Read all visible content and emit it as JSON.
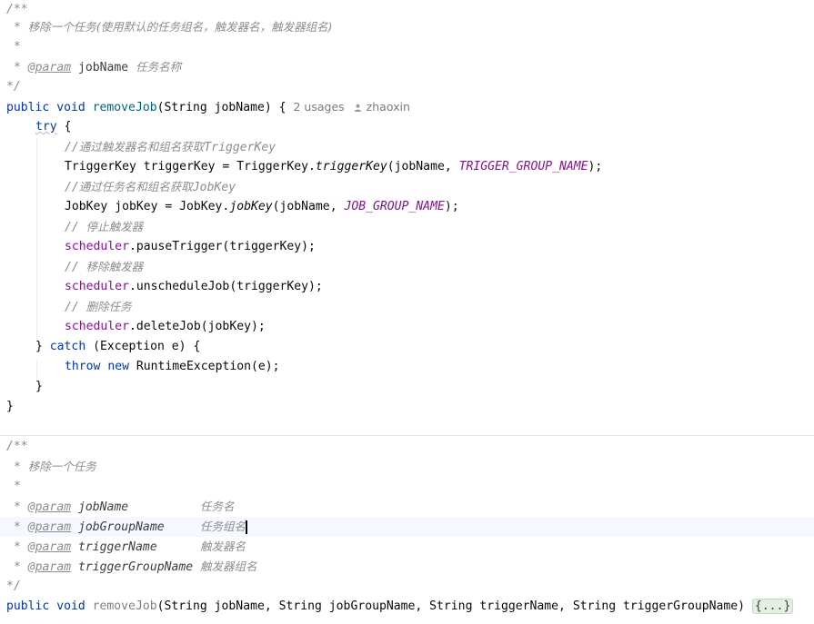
{
  "method1": {
    "doc_open": "/**",
    "doc_desc": "移除一个任务(使用默认的任务组名，触发器名，触发器组名)",
    "doc_star": "*",
    "doc_tag": "@param",
    "doc_param_name": "jobName",
    "doc_param_desc": "任务名称",
    "doc_close": "*/",
    "sig_public": "public",
    "sig_void": "void",
    "sig_name": "removeJob",
    "sig_params": "(String jobName) {",
    "usages": "2 usages",
    "author": "zhaoxin",
    "kw_try": "try",
    "brace_open": " {",
    "c1": "//",
    "c1_text": "通过触发器名和组名获取",
    "c1_tail": "TriggerKey",
    "l_triggerkey_a": "TriggerKey triggerKey = TriggerKey.",
    "l_triggerkey_m": "triggerKey",
    "l_triggerkey_b": "(jobName, ",
    "l_triggerkey_c": "TRIGGER_GROUP_NAME",
    "l_triggerkey_d": ");",
    "c2": "//",
    "c2_text": "通过任务名和组名获取",
    "c2_tail": "JobKey",
    "l_jobkey_a": "JobKey jobKey = JobKey.",
    "l_jobkey_m": "jobKey",
    "l_jobkey_b": "(jobName, ",
    "l_jobkey_c": "JOB_GROUP_NAME",
    "l_jobkey_d": ");",
    "c3": "// ",
    "c3_text": "停止触发器",
    "scheduler": "scheduler",
    "l_pause": ".pauseTrigger(triggerKey);",
    "c4": "// ",
    "c4_text": "移除触发器",
    "l_unschedule": ".unscheduleJob(triggerKey);",
    "c5": "// ",
    "c5_text": "删除任务",
    "l_delete": ".deleteJob(jobKey);",
    "catch_a": "} ",
    "kw_catch": "catch",
    "catch_b": " (Exception e) {",
    "kw_throw": "throw",
    "kw_new": "new",
    "throw_rest": " RuntimeException(e);",
    "close_inner": "}",
    "close_outer": "}"
  },
  "method2": {
    "doc_open": "/**",
    "doc_desc": "移除一个任务",
    "doc_star": "*",
    "params": [
      {
        "tag": "@param",
        "name": "jobName",
        "pad": "          ",
        "desc": "任务名"
      },
      {
        "tag": "@param",
        "name": "jobGroupName",
        "pad": "     ",
        "desc": "任务组名"
      },
      {
        "tag": "@param",
        "name": "triggerName",
        "pad": "      ",
        "desc": "触发器名"
      },
      {
        "tag": "@param",
        "name": "triggerGroupName",
        "pad": " ",
        "desc": "触发器组名"
      }
    ],
    "doc_close": "*/",
    "sig_public": "public",
    "sig_void": "void",
    "sig_name": "removeJob",
    "sig_params": "(String jobName, String jobGroupName, String triggerName, String triggerGroupName) ",
    "folded": "{...}"
  }
}
